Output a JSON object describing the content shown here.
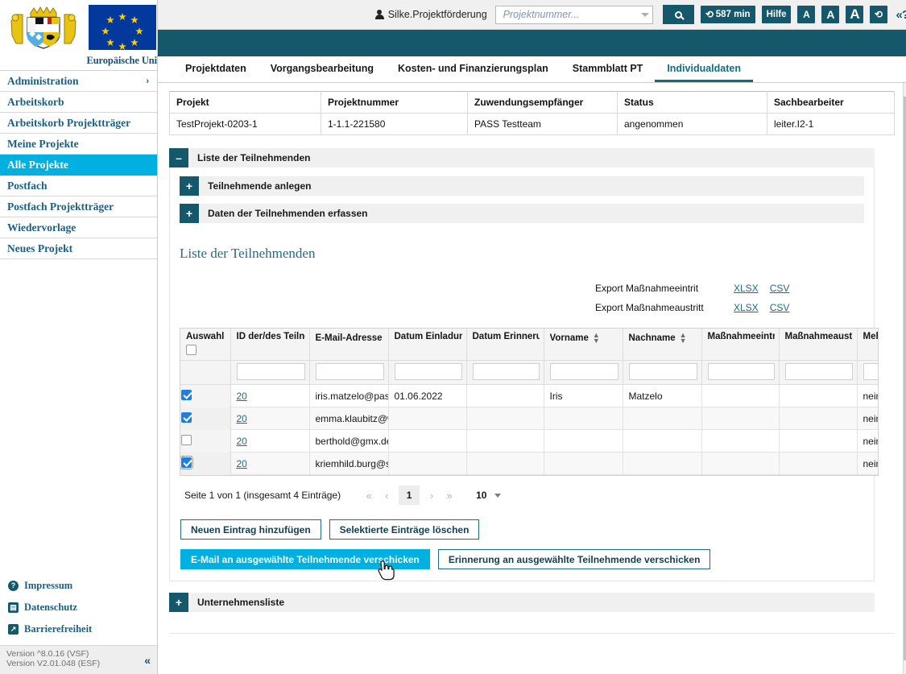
{
  "sidebar": {
    "eu_label": "Europäische Uni",
    "coat_of_arms_alt": "bavarian-coat-of-arms",
    "items": [
      {
        "label": "Administration",
        "chevron": "›",
        "active": false
      },
      {
        "label": "Arbeitskorb",
        "chevron": "",
        "active": false
      },
      {
        "label": "Arbeitskorb Projektträger",
        "chevron": "",
        "active": false
      },
      {
        "label": "Meine Projekte",
        "chevron": "",
        "active": false
      },
      {
        "label": "Alle Projekte",
        "chevron": "",
        "active": true
      },
      {
        "label": "Postfach",
        "chevron": "",
        "active": false
      },
      {
        "label": "Postfach Projektträger",
        "chevron": "",
        "active": false
      },
      {
        "label": "Wiedervorlage",
        "chevron": "",
        "active": false
      },
      {
        "label": "Neues Projekt",
        "chevron": "",
        "active": false
      }
    ],
    "footer_links": [
      {
        "label": "Impressum",
        "icon": "question-mark-circle-icon",
        "glyph": "?"
      },
      {
        "label": "Datenschutz",
        "icon": "book-icon",
        "glyph": "▤"
      },
      {
        "label": "Barrierefreiheit",
        "icon": "accessibility-arrow-icon",
        "glyph": "↗"
      }
    ],
    "version_line1": "Version ^8.0.16 (VSF)",
    "version_line2": "Version V2.01.048 (ESF)",
    "collapse_glyph": "«"
  },
  "topbar": {
    "user": "Silke.Projektförderung",
    "search_placeholder": "Projektnummer...",
    "search_value": "",
    "timer_label": "587 min",
    "help_label": "Hilfe",
    "font_small": "A",
    "font_medium": "A",
    "font_large": "A",
    "refresh_glyph": "⟳",
    "help_chevron": "«?"
  },
  "tabs": [
    {
      "label": "Projektdaten",
      "active": false
    },
    {
      "label": "Vorgangsbearbeitung",
      "active": false
    },
    {
      "label": "Kosten- und Finanzierungsplan",
      "active": false
    },
    {
      "label": "Stammblatt PT",
      "active": false
    },
    {
      "label": "Individualdaten",
      "active": true
    }
  ],
  "project_info": {
    "headers": [
      "Projekt",
      "Projektnummer",
      "Zuwendungsempfänger",
      "Status",
      "Sachbearbeiter"
    ],
    "row": [
      "TestProjekt-0203-1",
      "1-1.1-221580",
      "PASS Testteam",
      "angenommen",
      "leiter.I2-1"
    ]
  },
  "accordion": {
    "main_title": "Liste der Teilnehmenden",
    "main_toggle": "–",
    "sub_sections": [
      {
        "title": "Teilnehmende anlegen",
        "toggle": "+"
      },
      {
        "title": "Daten der Teilnehmenden erfassen",
        "toggle": "+"
      }
    ],
    "bottom_section": {
      "title": "Unternehmensliste",
      "toggle": "+"
    }
  },
  "section_title": "Liste der Teilnehmenden",
  "exports": [
    {
      "label": "Export Maßnahmeeintrit",
      "xlsx": "XLSX",
      "csv": "CSV"
    },
    {
      "label": "Export Maßnahmeaustritt",
      "xlsx": "XLSX",
      "csv": "CSV"
    }
  ],
  "grid": {
    "headers": [
      {
        "label": "Auswahl a",
        "sortable": false
      },
      {
        "label": "ID der/des Teilne",
        "sortable": false
      },
      {
        "label": "E-Mail-Adresse",
        "sortable": true
      },
      {
        "label": "Datum Einladung",
        "sortable": false
      },
      {
        "label": "Datum Erinnerun",
        "sortable": false
      },
      {
        "label": "Vorname",
        "sortable": true
      },
      {
        "label": "Nachname",
        "sortable": true
      },
      {
        "label": "Maßnahmeeintrit",
        "sortable": false
      },
      {
        "label": "Maßnahmeaustrit",
        "sortable": false
      },
      {
        "label": "Mehrfac",
        "sortable": false
      }
    ],
    "filters": [
      "",
      "",
      "",
      "",
      "",
      "",
      "",
      "",
      ""
    ],
    "rows": [
      {
        "selected": true,
        "focused": false,
        "id": "20",
        "email": "iris.matzelo@pass-co",
        "datum_einladung": "01.06.2022",
        "datum_erinnerung": "",
        "vorname": "Iris",
        "nachname": "Matzelo",
        "massnahmeeintritt": "",
        "massnahmeaustritt": "",
        "mehrfach": "nein"
      },
      {
        "selected": true,
        "focused": false,
        "id": "20",
        "email": "emma.klaubitz@web",
        "datum_einladung": "",
        "datum_erinnerung": "",
        "vorname": "",
        "nachname": "",
        "massnahmeeintritt": "",
        "massnahmeaustritt": "",
        "mehrfach": "nein"
      },
      {
        "selected": false,
        "focused": false,
        "id": "20",
        "email": "berthold@gmx.de",
        "datum_einladung": "",
        "datum_erinnerung": "",
        "vorname": "",
        "nachname": "",
        "massnahmeeintritt": "",
        "massnahmeaustritt": "",
        "mehrfach": "nein"
      },
      {
        "selected": true,
        "focused": true,
        "id": "20",
        "email": "kriemhild.burg@sieg",
        "datum_einladung": "",
        "datum_erinnerung": "",
        "vorname": "",
        "nachname": "",
        "massnahmeeintritt": "",
        "massnahmeaustritt": "",
        "mehrfach": "nein"
      }
    ]
  },
  "pager": {
    "info": "Seite 1 von 1 (insgesamt 4 Einträge)",
    "first": "«",
    "prev": "‹",
    "current_page": "1",
    "next": "›",
    "last": "»",
    "page_size": "10"
  },
  "buttons": {
    "add_entry": "Neuen Eintrag hinzufügen",
    "delete_selected": "Selektierte Einträge löschen",
    "send_email": "E-Mail an ausgewählte Teilnehmende verschicken",
    "send_reminder": "Erinnerung an ausgewählte Teilnehmende verschicken"
  },
  "colors": {
    "teal": "#15586b",
    "accent_cyan": "#00b0e0",
    "link": "#1f6a87",
    "checkbox_blue": "#1d7fe0"
  }
}
